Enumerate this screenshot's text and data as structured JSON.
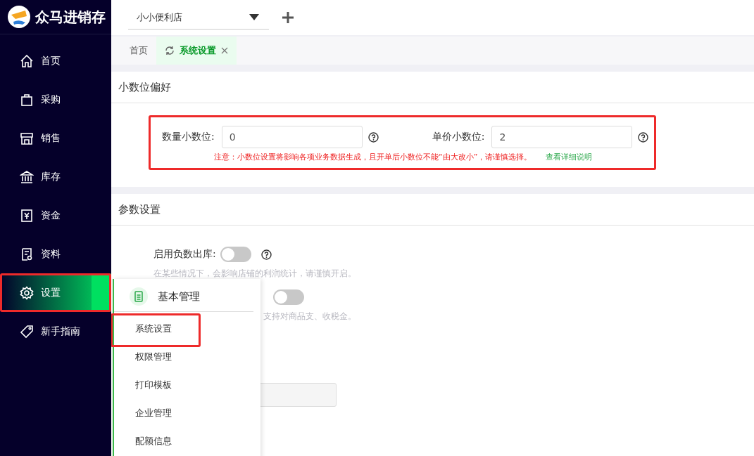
{
  "app": {
    "name": "众马进销存"
  },
  "sidebar": {
    "items": [
      {
        "label": "首页",
        "selected": false,
        "highlighted": false
      },
      {
        "label": "采购",
        "selected": false,
        "highlighted": false
      },
      {
        "label": "销售",
        "selected": false,
        "highlighted": false
      },
      {
        "label": "库存",
        "selected": false,
        "highlighted": false
      },
      {
        "label": "资金",
        "selected": false,
        "highlighted": false
      },
      {
        "label": "资料",
        "selected": false,
        "highlighted": false
      },
      {
        "label": "设置",
        "selected": true,
        "highlighted": true
      },
      {
        "label": "新手指南",
        "selected": false,
        "highlighted": false
      }
    ]
  },
  "shop_select": {
    "value": "小小便利店"
  },
  "tabs": [
    {
      "label": "首页",
      "selected": false,
      "closable": false
    },
    {
      "label": "系统设置",
      "selected": true,
      "closable": true
    }
  ],
  "decimal_section": {
    "title": "小数位偏好",
    "highlighted": true,
    "fields": [
      {
        "label": "数量小数位:",
        "value": "0"
      },
      {
        "label": "单价小数位:",
        "value": "2"
      }
    ],
    "notice": "注意：小数位设置将影响各项业务数据生成，且开单后小数位不能“由大改小”，请谨慎选择。",
    "link": "查看详细说明"
  },
  "param_section": {
    "title": "参数设置",
    "rows": [
      {
        "label": "启用负数出库:",
        "on": false,
        "hint": "在某些情况下，会影响店铺的利润统计，请谨慎开启。"
      },
      {
        "on": false,
        "hint": "支持对商品支、收税金。"
      }
    ]
  },
  "flyout": {
    "heading": "基本管理",
    "items": [
      {
        "label": "系统设置",
        "highlighted": true
      },
      {
        "label": "权限管理",
        "highlighted": false
      },
      {
        "label": "打印模板",
        "highlighted": false
      },
      {
        "label": "企业管理",
        "highlighted": false
      },
      {
        "label": "配额信息",
        "highlighted": false
      }
    ]
  }
}
